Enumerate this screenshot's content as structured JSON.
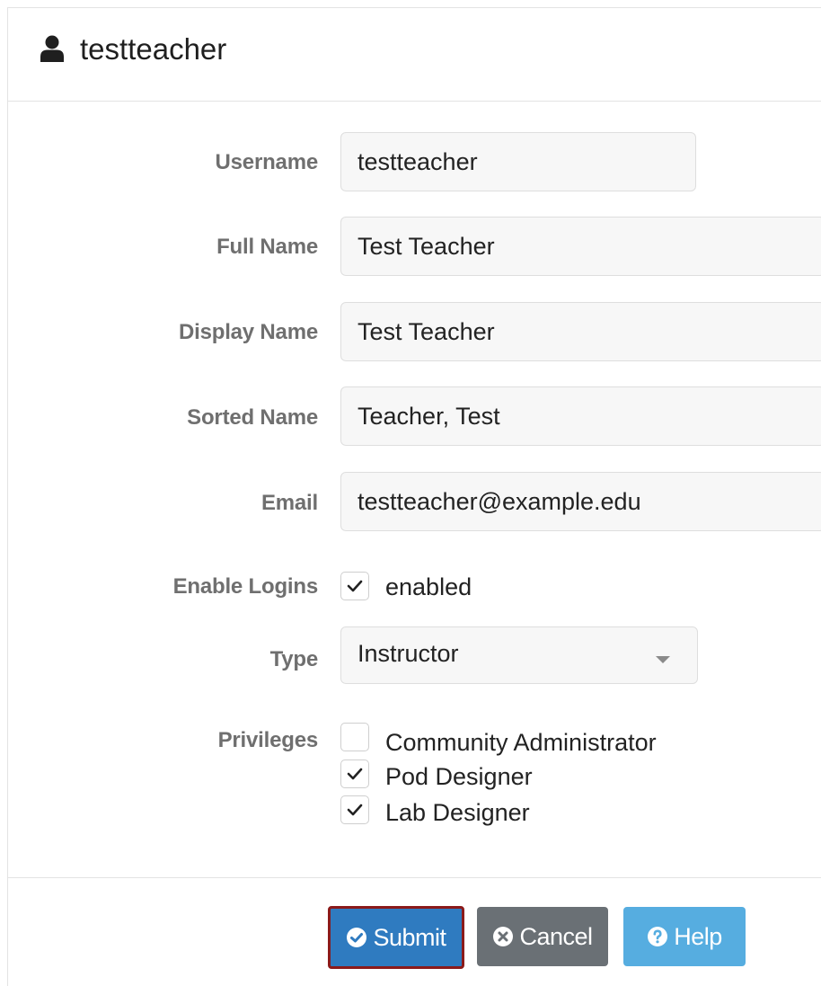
{
  "header": {
    "title": "testteacher",
    "icon": "user-icon"
  },
  "form": {
    "username": {
      "label": "Username",
      "value": "testteacher"
    },
    "full_name": {
      "label": "Full Name",
      "value": "Test Teacher"
    },
    "display_name": {
      "label": "Display Name",
      "value": "Test Teacher"
    },
    "sorted_name": {
      "label": "Sorted Name",
      "value": "Teacher, Test"
    },
    "email": {
      "label": "Email",
      "value": "testteacher@example.edu"
    },
    "enable_logins": {
      "label": "Enable Logins",
      "option_label": "enabled",
      "checked": true
    },
    "type": {
      "label": "Type",
      "value": "Instructor"
    },
    "privileges": {
      "label": "Privileges",
      "options": [
        {
          "label": "Community Administrator",
          "checked": false
        },
        {
          "label": "Pod Designer",
          "checked": true
        },
        {
          "label": "Lab Designer",
          "checked": true
        }
      ]
    }
  },
  "buttons": {
    "submit": {
      "label": "Submit",
      "icon": "check-circle-icon",
      "color": "#2f7bc0"
    },
    "cancel": {
      "label": "Cancel",
      "icon": "x-circle-icon",
      "color": "#6a7075"
    },
    "help": {
      "label": "Help",
      "icon": "question-circle-icon",
      "color": "#56ade0"
    }
  }
}
